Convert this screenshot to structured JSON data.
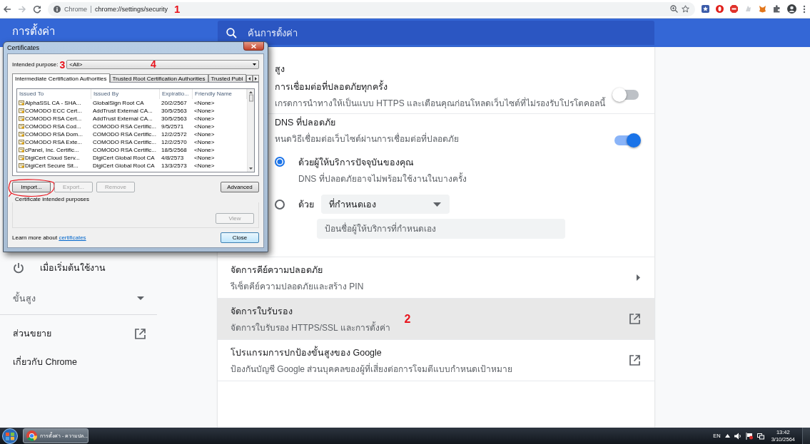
{
  "browser": {
    "site_label": "Chrome",
    "url": "chrome://settings/security",
    "annotation": "1"
  },
  "header": {
    "title": "การตั้งค่า",
    "search_placeholder": "ค้นการตั้งค่า"
  },
  "sidebar": {
    "items": [
      {
        "kind": "power",
        "label": "เมื่อเริ่มต้นใช้งาน"
      },
      {
        "kind": "collapsible",
        "label": "ขั้นสูง",
        "expanded": false
      },
      {
        "kind": "external",
        "label": "ส่วนขยาย"
      },
      {
        "kind": "plain",
        "label": "เกี่ยวกับ Chrome"
      }
    ]
  },
  "main": {
    "section_title": "สูง",
    "rows": [
      {
        "kind": "toggle",
        "title": "การเชื่อมต่อที่ปลอดภัยทุกครั้ง",
        "subtitle": "เกรดการนำทางให้เป็นแบบ HTTPS และเตือนคุณก่อนโหลดเว็บไซต์ที่ไม่รองรับโปรโตคอลนี้",
        "on": false
      },
      {
        "kind": "toggle",
        "title": "DNS ที่ปลอดภัย",
        "subtitle": "หนดวิธีเชื่อมต่อเว็บไซต์ผ่านการเชื่อมต่อที่ปลอดภัย",
        "on": true,
        "options": [
          {
            "kind": "radio",
            "title": "ด้วยผู้ให้บริการปัจจุบันของคุณ",
            "subtitle": "DNS ที่ปลอดภัยอาจไม่พร้อมใช้งานในบางครั้ง",
            "selected": true
          },
          {
            "kind": "custom",
            "label": "ด้วย",
            "dropdown": "ที่กำหนดเอง",
            "placeholder": "ป้อนชื่อผู้ให้บริการที่กำหนดเอง",
            "selected": false
          }
        ]
      },
      {
        "kind": "submenu",
        "title": "จัดการคีย์ความปลอดภัย",
        "subtitle": "รีเซ็ตคีย์ความปลอดภัยและสร้าง PIN",
        "highlighted": false
      },
      {
        "kind": "external",
        "title": "จัดการใบรับรอง",
        "subtitle": "จัดการใบรับรอง HTTPS/SSL และการตั้งค่า",
        "highlighted": true,
        "annotation": "2"
      },
      {
        "kind": "external",
        "title": "โปรแกรมการปกป้องขั้นสูงของ Google",
        "subtitle": "ป้องกันบัญชี Google ส่วนบุคคลของผู้ที่เสี่ยงต่อการโจมตีแบบกำหนดเป้าหมาย",
        "highlighted": false
      }
    ]
  },
  "dialog": {
    "title": "Certificates",
    "purpose_label": "Intended purpose:",
    "purpose_annotation": "3",
    "purpose_value": "<All>",
    "value_annotation": "4",
    "tabs": [
      {
        "label": "Intermediate Certification Authorities",
        "selected": true
      },
      {
        "label": "Trusted Root Certification Authorities",
        "selected": false
      },
      {
        "label": "Trusted Publ",
        "selected": false
      }
    ],
    "columns": [
      "Issued To",
      "Issued By",
      "Expiratio...",
      "Friendly Name"
    ],
    "rows": [
      [
        "AlphaSSL CA - SHA...",
        "GlobalSign Root CA",
        "20/2/2567",
        "<None>"
      ],
      [
        "COMODO ECC Cert...",
        "AddTrust External CA...",
        "30/5/2563",
        "<None>"
      ],
      [
        "COMODO RSA Cert...",
        "AddTrust External CA...",
        "30/5/2563",
        "<None>"
      ],
      [
        "COMODO RSA Cod...",
        "COMODO RSA Certific...",
        "9/5/2571",
        "<None>"
      ],
      [
        "COMODO RSA Dom...",
        "COMODO RSA Certific...",
        "12/2/2572",
        "<None>"
      ],
      [
        "COMODO RSA Exte...",
        "COMODO RSA Certific...",
        "12/2/2570",
        "<None>"
      ],
      [
        "cPanel, Inc. Certific...",
        "COMODO RSA Certific...",
        "18/5/2568",
        "<None>"
      ],
      [
        "DigiCert Cloud Serv...",
        "DigiCert Global Root CA",
        "4/8/2573",
        "<None>"
      ],
      [
        "DigiCert Secure Sit...",
        "DigiCert Global Root CA",
        "13/3/2573",
        "<None>"
      ]
    ],
    "buttons": [
      {
        "label": "Import...",
        "disabled": false,
        "circled": true
      },
      {
        "label": "Export...",
        "disabled": true,
        "circled": false
      },
      {
        "label": "Remove",
        "disabled": true,
        "circled": false
      },
      {
        "label": "Advanced",
        "disabled": false,
        "circled": false
      }
    ],
    "group_label": "Certificate intended purposes",
    "view_button": {
      "label": "View",
      "disabled": true
    },
    "learn_more": "Learn more about",
    "link": "certificates",
    "close": "Close"
  },
  "taskbar": {
    "task": "การตั้งค่า - ความปล...",
    "language": "EN",
    "time": "13:42",
    "date": "3/10/2564"
  }
}
